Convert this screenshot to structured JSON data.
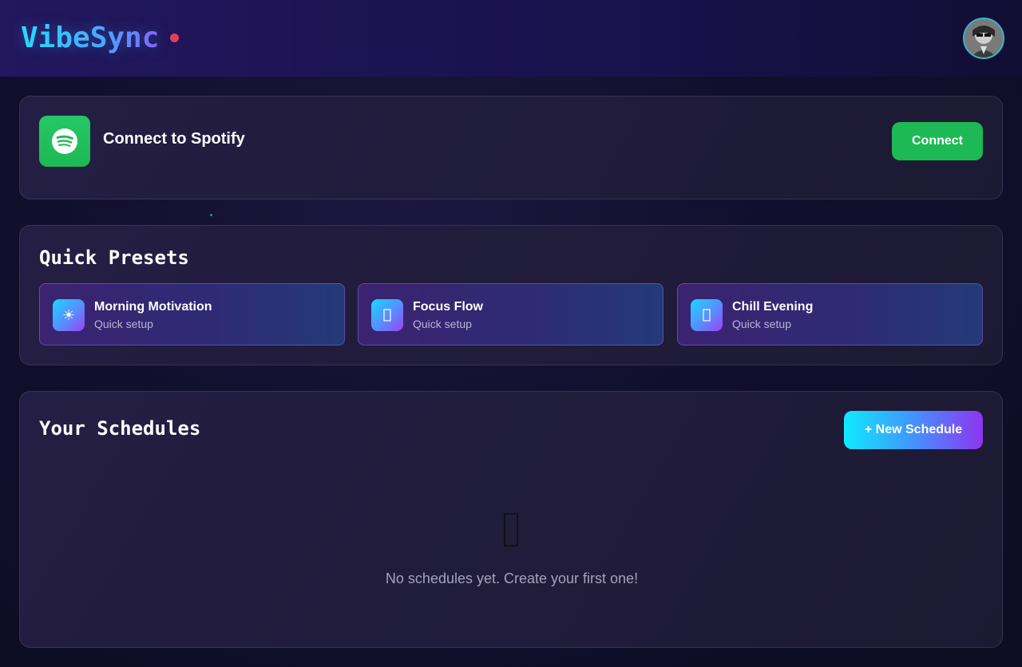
{
  "header": {
    "brand": "VibeSync",
    "status_color": "#e0405a",
    "avatar_icon": "user-avatar"
  },
  "spotify": {
    "title": "Connect to Spotify",
    "connect_label": "Connect",
    "brand_color": "#1db954",
    "icon": "spotify-icon"
  },
  "presets": {
    "title": "Quick Presets",
    "items": [
      {
        "name": "Morning Motivation",
        "subtitle": "Quick setup",
        "icon": "sun-icon",
        "glyph": "☀"
      },
      {
        "name": "Focus Flow",
        "subtitle": "Quick setup",
        "icon": "preset-icon"
      },
      {
        "name": "Chill Evening",
        "subtitle": "Quick setup",
        "icon": "preset-icon"
      }
    ]
  },
  "schedules": {
    "title": "Your Schedules",
    "new_label": "+ New Schedule",
    "empty_text": "No schedules yet. Create your first one!",
    "empty_icon": "empty-state-icon"
  }
}
